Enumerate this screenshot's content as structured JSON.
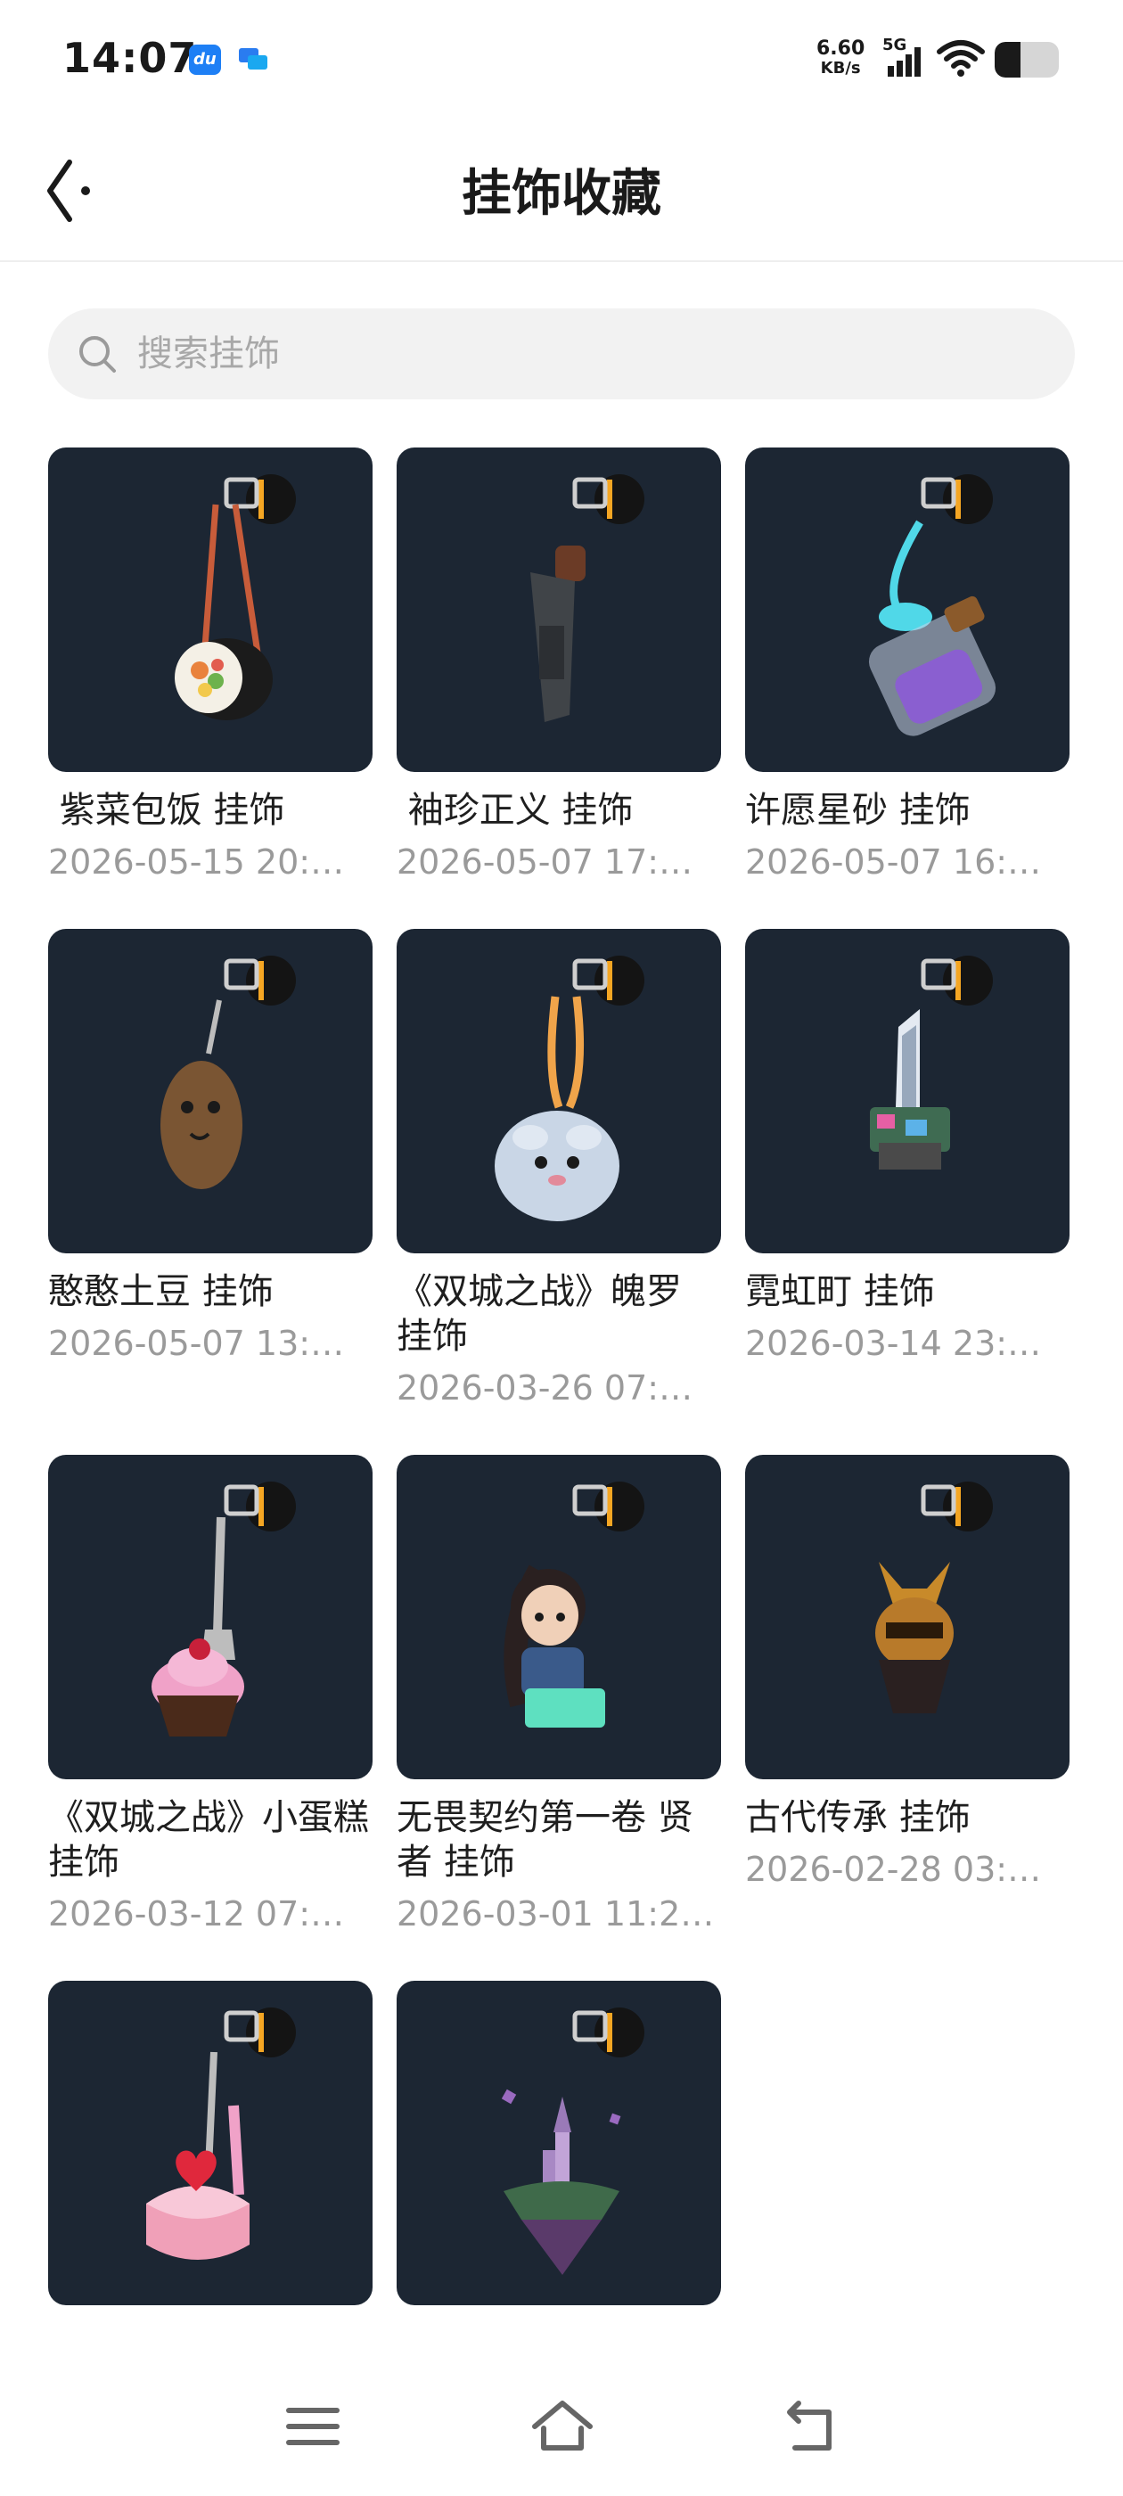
{
  "status_bar": {
    "time": "14:07",
    "net_speed": "6.60",
    "net_speed_unit": "KB/s",
    "network_type": "5G",
    "battery_level": 0.4,
    "icons": [
      "baidu-app-icon",
      "message-app-icon",
      "signal-icon",
      "wifi-icon",
      "battery-icon"
    ]
  },
  "header": {
    "title": "挂饰收藏",
    "back_icon": "chevron-left-icon"
  },
  "search": {
    "placeholder": "搜索挂饰",
    "value": "",
    "icon": "search-icon"
  },
  "colors": {
    "thumb_bg": "#1c2633",
    "accent_orange": "#f5a623",
    "date_text": "#9a9a9a"
  },
  "items": [
    {
      "name": " 紫菜包饭 挂饰",
      "date": "2026-05-15 20:…",
      "art": "sushi"
    },
    {
      "name": " 袖珍正义 挂饰",
      "date": "2026-05-07 17:…",
      "art": "gun"
    },
    {
      "name": "许愿星砂 挂饰",
      "date": "2026-05-07 16:…",
      "art": "bottle"
    },
    {
      "name": "憨憨土豆 挂饰",
      "date": "2026-05-07 13:…",
      "art": "potato"
    },
    {
      "name": "《双城之战》魄罗 挂饰",
      "date": "2026-03-26 07:…",
      "art": "poro"
    },
    {
      "name": "霓虹町 挂饰",
      "date": "2026-03-14 23:…",
      "art": "tower"
    },
    {
      "name": "《双城之战》小蛋糕 挂饰",
      "date": "2026-03-12 07:…",
      "art": "cupcake"
    },
    {
      "name": "无畏契约第一卷 贤者 挂饰",
      "date": "2026-03-01 11:2…",
      "art": "sage"
    },
    {
      "name": "古代传承 挂饰",
      "date": "2026-02-28 03:…",
      "art": "samurai"
    },
    {
      "name": "",
      "date": "",
      "art": "cake"
    },
    {
      "name": "",
      "date": "",
      "art": "island"
    }
  ],
  "nav_bar": {
    "buttons": [
      "menu-icon",
      "home-icon",
      "back-icon"
    ]
  }
}
